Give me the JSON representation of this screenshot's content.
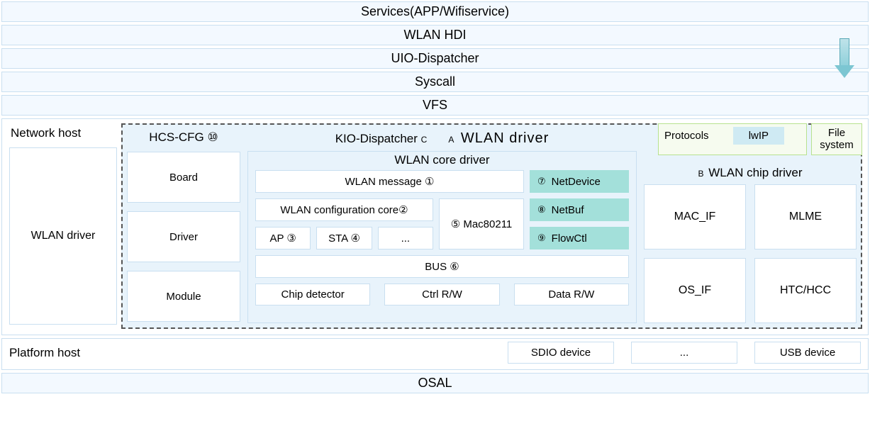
{
  "rows": {
    "services": "Services(APP/Wifiservice)",
    "hdi": "WLAN HDI",
    "uio": "UIO-Dispatcher",
    "syscall": "Syscall",
    "vfs": "VFS",
    "osal": "OSAL"
  },
  "network_host": {
    "title": "Network host",
    "driver": "WLAN driver"
  },
  "hcs": {
    "title": "HCS-CFG ⑩",
    "items": [
      "Board",
      "Driver",
      "Module"
    ]
  },
  "center": {
    "kio": "KIO-Dispatcher",
    "kio_letter": "C",
    "title_letter": "A",
    "title": "WLAN  driver",
    "core_title": "WLAN core driver",
    "msg": "WLAN message  ①",
    "cfg": "WLAN configuration core②",
    "mac": "⑤ Mac80211",
    "ap": "AP ③",
    "sta": "STA ④",
    "dots": "...",
    "netdev_n": "⑦",
    "netdev": "NetDevice",
    "netbuf_n": "⑧",
    "netbuf": "NetBuf",
    "flow_n": "⑨",
    "flow": "FlowCtl",
    "bus": "BUS  ⑥",
    "chipdet": "Chip detector",
    "ctrl": "Ctrl R/W",
    "data": "Data R/W"
  },
  "protocols": {
    "label": "Protocols",
    "lwip": "lwIP",
    "fs": "File system"
  },
  "chip": {
    "letter": "B",
    "title": "WLAN chip driver",
    "items": [
      "MAC_IF",
      "MLME",
      "OS_IF",
      "HTC/HCC"
    ]
  },
  "platform": {
    "title": "Platform host",
    "items": [
      "SDIO device",
      "...",
      "USB device"
    ]
  }
}
